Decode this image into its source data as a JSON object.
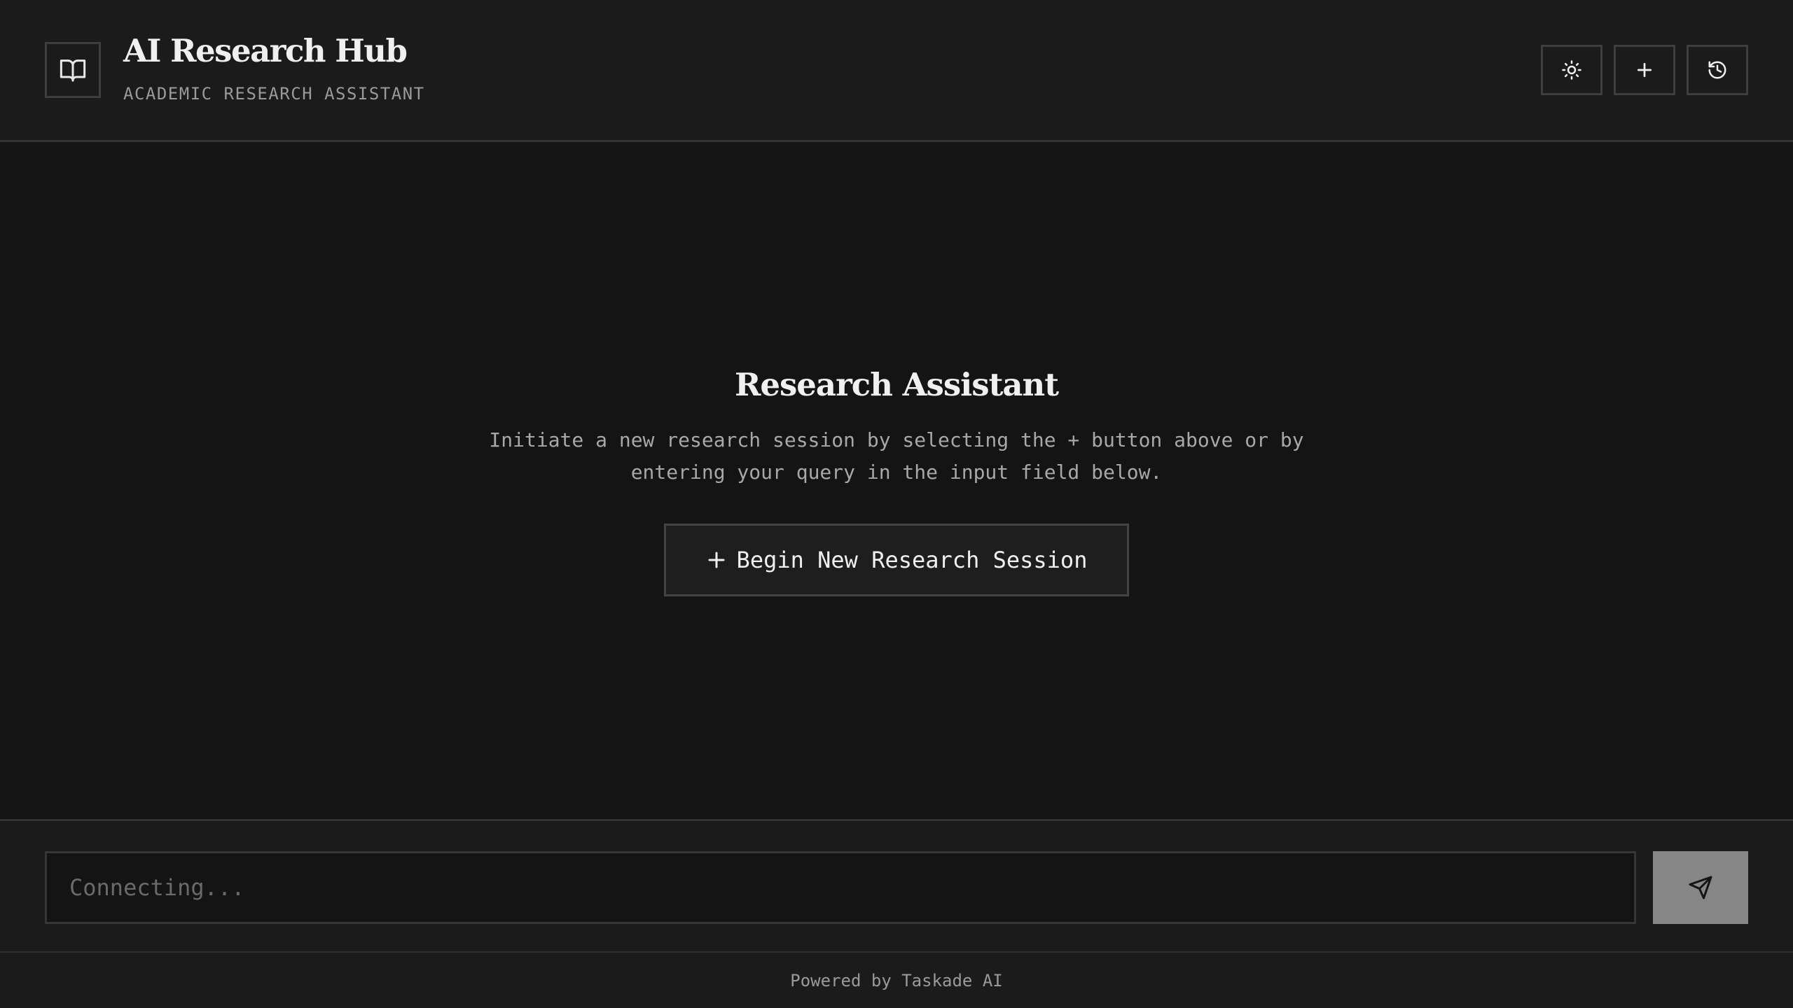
{
  "header": {
    "logo_icon": "book-open-icon",
    "title": "AI Research Hub",
    "subtitle": "ACADEMIC RESEARCH ASSISTANT",
    "actions": [
      {
        "icon": "sun-icon",
        "purpose": "toggle theme"
      },
      {
        "icon": "plus-icon",
        "purpose": "new session"
      },
      {
        "icon": "history-icon",
        "purpose": "session history"
      }
    ]
  },
  "empty_state": {
    "title": "Research Assistant",
    "description": "Initiate a new research session by selecting the + button above or by entering your query in the input field below.",
    "button_icon": "plus-icon",
    "button_label": "Begin New Research Session"
  },
  "composer": {
    "placeholder": "Connecting...",
    "value": "",
    "send_icon": "send-icon"
  },
  "footer": {
    "text": "Powered by Taskade AI"
  },
  "colors": {
    "background": "#141414",
    "panel": "#1b1b1b",
    "border": "#3d3d3d",
    "text": "#f0f0f0",
    "muted_text": "#9a9a9a",
    "send_button": "#868686"
  }
}
